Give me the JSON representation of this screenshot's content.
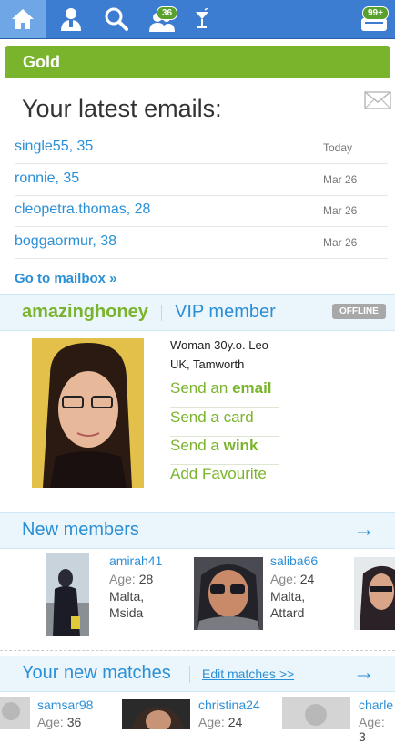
{
  "topbar": {
    "icons": [
      "home-icon",
      "profile-icon",
      "search-icon",
      "visitors-icon",
      "cocktail-icon",
      "messages-icon"
    ],
    "visitors_badge": "36",
    "messages_badge": "99+"
  },
  "membership": {
    "label": "Gold"
  },
  "emails": {
    "title": "Your latest emails:",
    "items": [
      {
        "name": "single55, 35",
        "date": "Today"
      },
      {
        "name": "ronnie, 35",
        "date": "Mar 26"
      },
      {
        "name": "cleopetra.thomas, 28",
        "date": "Mar 26"
      },
      {
        "name": "boggaormur, 38",
        "date": "Mar 26"
      }
    ],
    "mailbox_link": "Go to mailbox »"
  },
  "vip": {
    "username": "amazinghoney",
    "label": "VIP member",
    "status": "OFFLINE",
    "details_line1": "Woman 30y.o. Leo",
    "details_line2": "UK, Tamworth",
    "actions": {
      "send_email_prefix": "Send an ",
      "send_email_bold": "email",
      "send_card": "Send a card",
      "send_wink_prefix": "Send a ",
      "send_wink_bold": "wink",
      "add_favourite": "Add Favourite"
    }
  },
  "new_members": {
    "title": "New members",
    "arrow": "→",
    "age_label": "Age:",
    "items": [
      {
        "name": "amirah41",
        "age": "28",
        "city_line1": "Malta,",
        "city_line2": "Msida"
      },
      {
        "name": "saliba66",
        "age": "24",
        "city_line1": "Malta,",
        "city_line2": "Attard"
      }
    ]
  },
  "new_matches": {
    "title": "Your new matches",
    "edit_link": "Edit matches >>",
    "arrow": "→",
    "age_label": "Age:",
    "items": [
      {
        "name": "samsar98",
        "age": "36"
      },
      {
        "name": "christina24",
        "age": "24"
      },
      {
        "name": "charle",
        "age": "3"
      }
    ]
  },
  "colors": {
    "topbar": "#3d7dd1",
    "gold": "#7ab42c",
    "link": "#2b8fd6",
    "section_bg": "#eaf6fc"
  }
}
